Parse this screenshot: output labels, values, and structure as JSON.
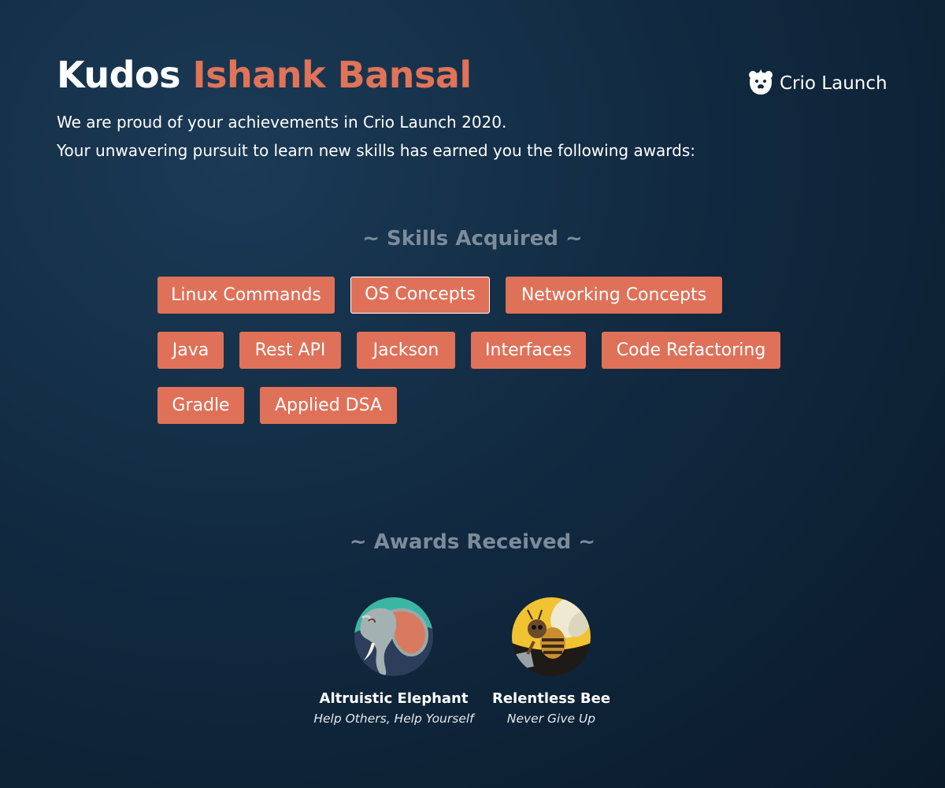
{
  "header": {
    "kudos": "Kudos",
    "name": "Ishank Bansal",
    "line1": "We are proud of your achievements in Crio Launch 2020.",
    "line2": "Your unwavering pursuit to learn new skills has earned you the following awards:"
  },
  "brand": {
    "text": "Crio Launch",
    "icon": "bear-logo-icon"
  },
  "skills": {
    "title": "~ Skills Acquired ~",
    "items": [
      "Linux Commands",
      "OS Concepts",
      "Networking Concepts",
      "Java",
      "Rest API",
      "Jackson",
      "Interfaces",
      "Code Refactoring",
      "Gradle",
      "Applied DSA"
    ],
    "highlighted": "OS Concepts"
  },
  "awards": {
    "title": "~ Awards Received ~",
    "items": [
      {
        "name": "Altruistic Elephant",
        "motto": "Help Others, Help Yourself",
        "icon": "elephant-badge-icon"
      },
      {
        "name": "Relentless Bee",
        "motto": "Never Give Up",
        "icon": "bee-badge-icon"
      }
    ]
  },
  "colors": {
    "accent": "#df7159",
    "background": "#112a41",
    "muted_text": "#7d8c9a"
  }
}
